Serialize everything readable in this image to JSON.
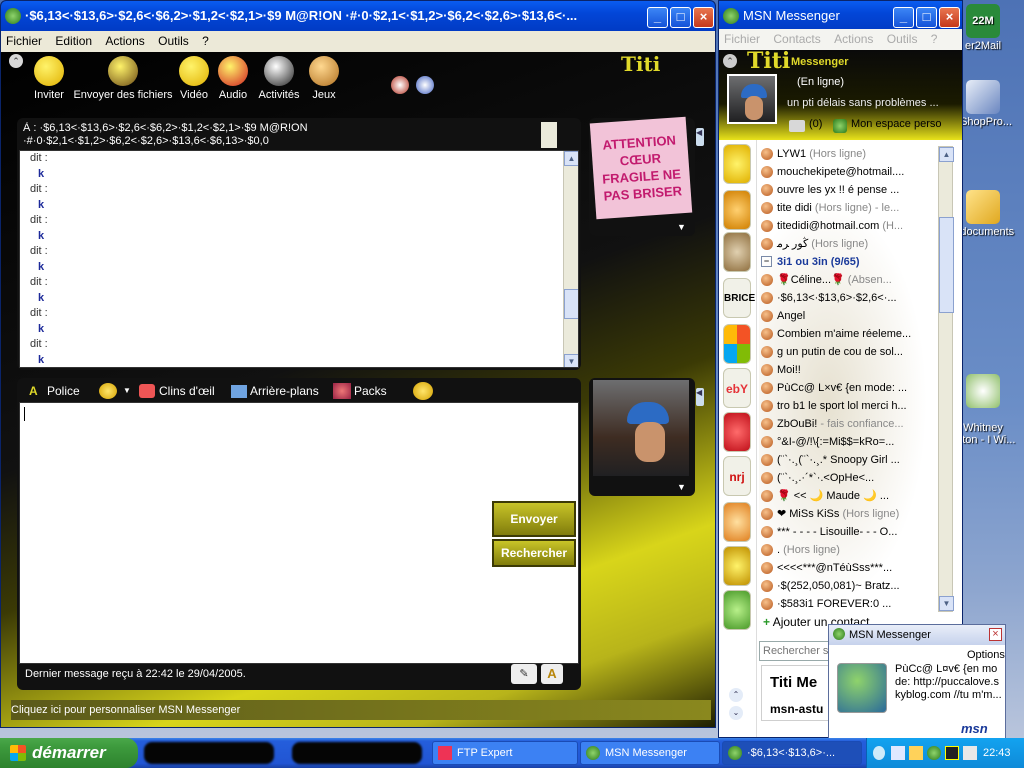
{
  "desktop": {
    "icons": [
      {
        "name": "mail-icon",
        "label": "er2Mail",
        "badge": "22M"
      },
      {
        "name": "shop-icon",
        "label": "eShopPro..."
      },
      {
        "name": "documents-icon",
        "label": "s documents"
      },
      {
        "name": "music-icon",
        "label": "Whitney\nuston - I Wi..."
      }
    ]
  },
  "chat": {
    "title": "·$6,13<·$13,6>·$2,6<·$6,2>·$1,2<·$2,1>·$9 M@R!ON ·#·0·$2,1<·$1,2>·$6,2<·$2,6>·$13,6<·...",
    "menu": [
      "Fichier",
      "Edition",
      "Actions",
      "Outils",
      "?"
    ],
    "toolbar": [
      "Inviter",
      "Envoyer des fichiers",
      "Vidéo",
      "Audio",
      "Activités",
      "Jeux"
    ],
    "brand": "Titi",
    "to_prefix": "À :",
    "to_name": "·$6,13<·$13,6>·$2,6<·$6,2>·$1,2<·$2,1>·$9 M@R!ON ·#·0·$2,1<·$1,2>·$6,2<·$2,6>·$13,6<·$6,13>·$0,0",
    "messages": [
      {
        "who": "dit :",
        "text": "k"
      },
      {
        "who": "dit :",
        "text": "k"
      },
      {
        "who": "dit :",
        "text": "k"
      },
      {
        "who": "dit :",
        "text": "k"
      },
      {
        "who": "dit :",
        "text": "k"
      },
      {
        "who": "dit :",
        "text": "k"
      },
      {
        "who": "dit :",
        "text": "k"
      }
    ],
    "format_bar": {
      "font": "Police",
      "winks": "Clins d'œil",
      "backgrounds": "Arrière-plans",
      "packs": "Packs"
    },
    "send": "Envoyer",
    "search": "Rechercher",
    "last_msg": "Dernier message reçu à 22:42 le 29/04/2005.",
    "customize": "Cliquez ici pour personnaliser MSN Messenger",
    "contact_pic_text": "ATTENTION CŒUR FRAGILE NE PAS BRISER"
  },
  "msn": {
    "title": "MSN Messenger",
    "menu": [
      "Fichier",
      "Contacts",
      "Actions",
      "Outils",
      "?"
    ],
    "brand": "Titi",
    "brand_sub": "Messenger",
    "status": "(En ligne)",
    "personal_msg": "un pti délais sans problèmes ...",
    "mail_count": "(0)",
    "my_space": "Mon espace perso",
    "contacts": [
      {
        "name": "LYW1",
        "status": " (Hors ligne)"
      },
      {
        "name": "mouchekipete@hotmail....",
        "status": ""
      },
      {
        "name": "ouvre les yx !! é pense ...",
        "status": ""
      },
      {
        "name": "tite didi",
        "status": " (Hors ligne) - le..."
      },
      {
        "name": "titedidi@hotmail.com",
        "status": " (H..."
      },
      {
        "name": "ﯕﻮﺭ ﺮﻣ",
        "status": " (Hors ligne)"
      }
    ],
    "group": "3i1 ou 3in (9/65)",
    "group_contacts": [
      {
        "name": "🌹Céline...🌹",
        "status": " (Absen..."
      },
      {
        "name": "·$6,13<·$13,6>·$2,6<·...",
        "status": ""
      },
      {
        "name": "Angel",
        "status": ""
      },
      {
        "name": "Combien m'aime réeleme...",
        "status": ""
      },
      {
        "name": "g un putin de cou de sol...",
        "status": ""
      },
      {
        "name": "Moi!!",
        "status": ""
      },
      {
        "name": "PùCc@ L×v€ {en mode: ...",
        "status": ""
      },
      {
        "name": "tro b1 le sport lol merci h...",
        "status": ""
      },
      {
        "name": "ZbOuBi!",
        "status": " - fais confiance..."
      },
      {
        "name": "°&I-@/!\\{:=Mi$$=kRo=...",
        "status": ""
      },
      {
        "name": "(¨`·.¸(¨`·.¸.* Snoopy Girl ...",
        "status": ""
      },
      {
        "name": "(¨`·.¸.·´*`·.<OpHe<...",
        "status": ""
      },
      {
        "name": "🌹 << 🌙 Maude 🌙 ...",
        "status": ""
      },
      {
        "name": "❤ MiSs KiSs",
        "status": " (Hors ligne)"
      },
      {
        "name": "*** - - - - Lisouille- - - O...",
        "status": ""
      },
      {
        "name": ".",
        "status": " (Hors ligne)"
      },
      {
        "name": "<<<<***@nTéùSss***...",
        "status": ""
      },
      {
        "name": "·$(252,050,081)~ Bratz...",
        "status": ""
      },
      {
        "name": "·$583i1 FOREVER:0 ...",
        "status": ""
      }
    ],
    "add_contact": "Ajouter un contact",
    "search_placeholder": "Rechercher s",
    "ad_title": "Titi Me",
    "ad_sub": "msn-astu"
  },
  "toast": {
    "title": "MSN Messenger",
    "options": "Options",
    "text": "PùCc@ L¤v€ {en mode: http://puccalove.skyblog.com //tu m'm...",
    "logo": "msn"
  },
  "taskbar": {
    "start": "démarrer",
    "tasks": [
      "FTP Expert",
      "MSN Messenger",
      "·$6,13<·$13,6>·..."
    ],
    "clock": "22:43"
  },
  "colors": {
    "xp_blue": "#0246d8",
    "accent_yellow": "#d8d51a",
    "taskbar": "#245edc",
    "start_green": "#3d9a3d"
  }
}
